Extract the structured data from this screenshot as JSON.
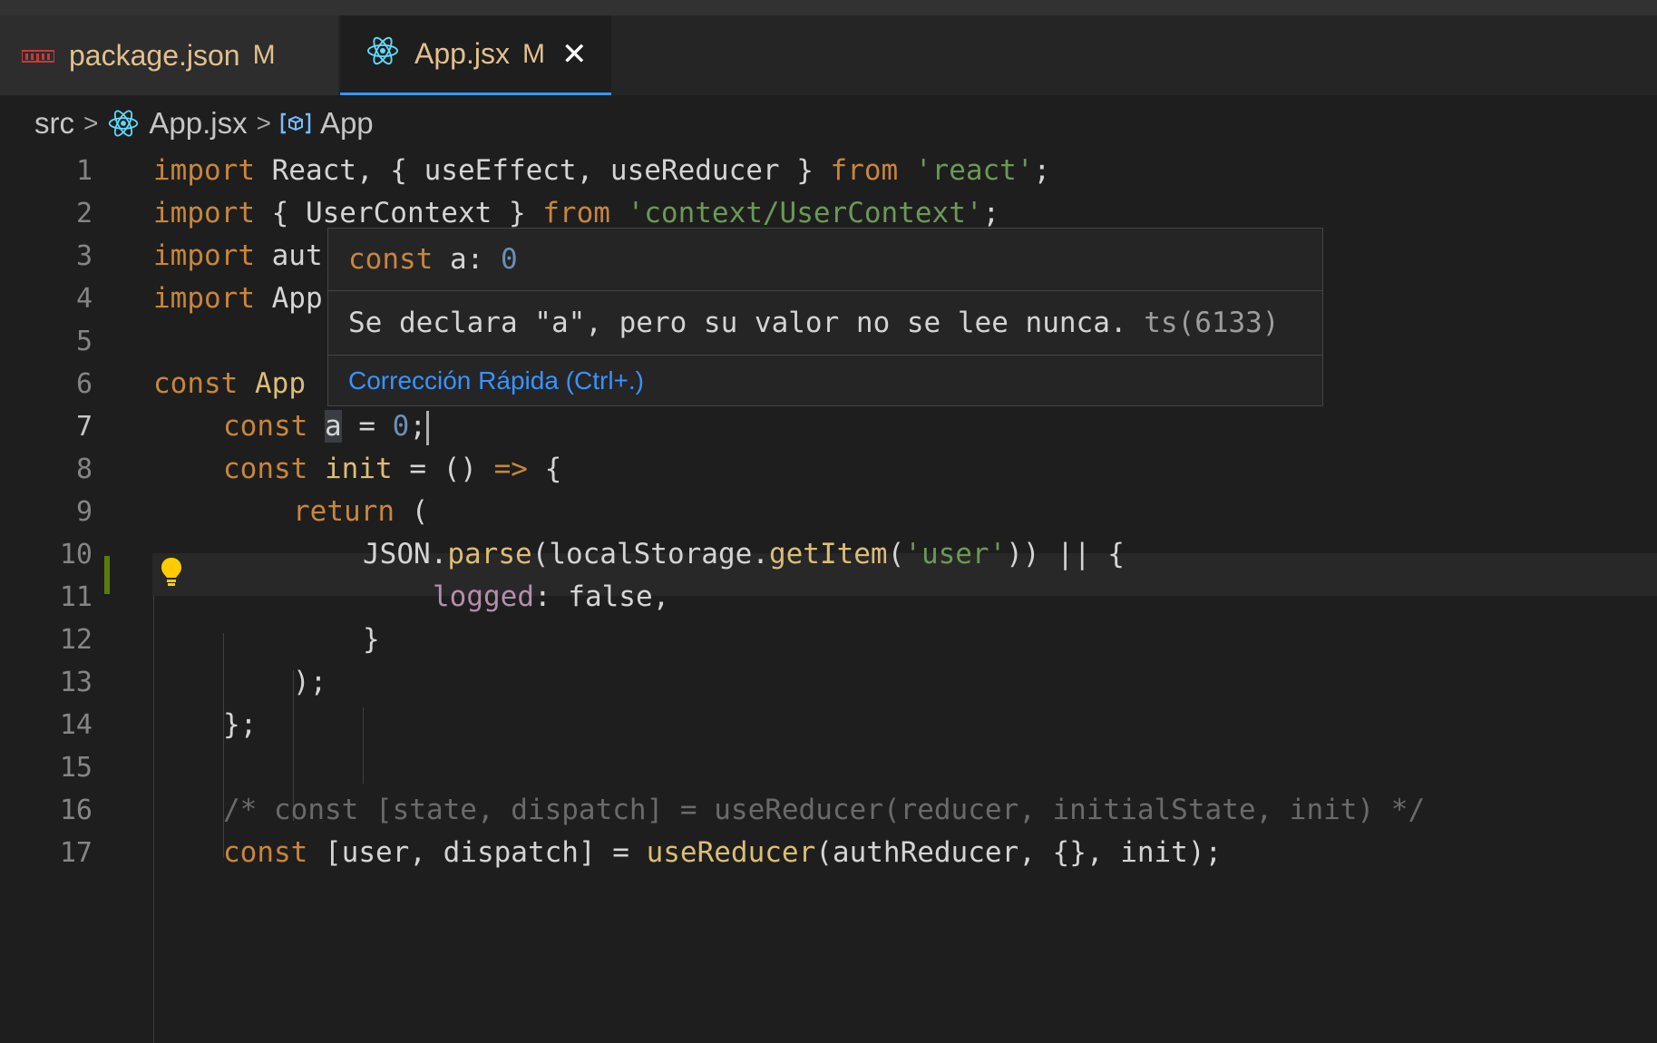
{
  "tabs": [
    {
      "icon": "npm-icon",
      "label": "package.json",
      "modified": "M"
    },
    {
      "icon": "react-icon",
      "label": "App.jsx",
      "modified": "M",
      "close": "✕",
      "active": true
    }
  ],
  "breadcrumb": {
    "folder": "src",
    "file": "App.jsx",
    "symbol": "App",
    "separator": ">"
  },
  "editor": {
    "line_numbers": [
      "1",
      "2",
      "3",
      "4",
      "5",
      "6",
      "7",
      "8",
      "9",
      "10",
      "11",
      "12",
      "13",
      "14",
      "15",
      "16",
      "17"
    ],
    "active_line": "7",
    "lines": {
      "l1": {
        "k1": "import",
        "t1": " React, { useEffect, useReducer } ",
        "k2": "from",
        "s1": " 'react'",
        "t2": ";"
      },
      "l2": {
        "k1": "import",
        "t1": " { UserContext } ",
        "k2": "from",
        "s1": " 'context/UserContext'",
        "t2": ";"
      },
      "l3": {
        "k1": "import",
        "t1": " aut"
      },
      "l4": {
        "k1": "import",
        "t1": " App"
      },
      "l6": {
        "k1": "const",
        "f1": " App"
      },
      "l7": {
        "k1": "const",
        "t0": " ",
        "v1": "a",
        "t1": " = ",
        "n1": "0",
        "t2": ";"
      },
      "l8": {
        "k1": "const",
        "f1": " init",
        "t1": " = () ",
        "k2": "=>",
        "t2": " {"
      },
      "l9": {
        "k1": "return",
        "t1": " ("
      },
      "l10": {
        "t1": "JSON.",
        "f1": "parse",
        "t2": "(localStorage.",
        "f2": "getItem",
        "t3": "(",
        "s1": "'user'",
        "t4": ")) || {"
      },
      "l11": {
        "p1": "logged",
        "t1": ": false,"
      },
      "l12": {
        "t1": "}"
      },
      "l13": {
        "t1": ");"
      },
      "l14": {
        "t1": "};"
      },
      "l16": {
        "c1": "/* const [state, dispatch] = useReducer(reducer, initialState, init) */"
      },
      "l17": {
        "k1": "const",
        "t1": " [user, dispatch] = ",
        "f1": "useReducer",
        "t2": "(authReducer, {}, init);"
      }
    }
  },
  "hover": {
    "sig_keyword": "const",
    "sig_name": " a: ",
    "sig_value": "0",
    "message": "Se declara \"a\", pero su valor no se lee nunca. ",
    "code": "ts(6133)",
    "action": "Corrección Rápida (Ctrl+.)"
  },
  "colors": {
    "keyword": "#c8863c",
    "function": "#dcbd75",
    "string": "#6a9955",
    "number": "#6b8fb5",
    "property": "#b48ead",
    "comment": "#6a6a6a",
    "link": "#3794ff",
    "modified_gutter": "#587c0c"
  }
}
